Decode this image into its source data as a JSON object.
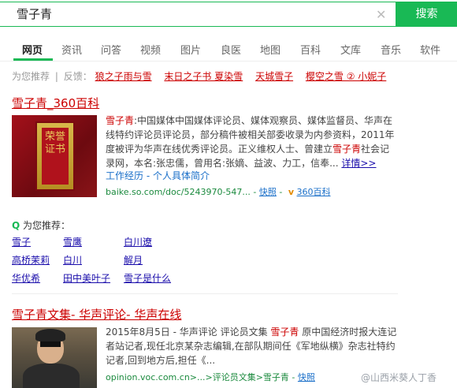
{
  "search": {
    "left_icon": "索",
    "query": "雪子青",
    "clear_icon": "clear-icon",
    "button_label": "搜索"
  },
  "tabs": [
    {
      "label": "网页",
      "active": true
    },
    {
      "label": "资讯"
    },
    {
      "label": "问答"
    },
    {
      "label": "视频"
    },
    {
      "label": "图片"
    },
    {
      "label": "良医"
    },
    {
      "label": "地图"
    },
    {
      "label": "百科"
    },
    {
      "label": "文库"
    },
    {
      "label": "音乐"
    },
    {
      "label": "软件"
    }
  ],
  "recommend_row": {
    "prefix": "为您推荐",
    "separator": "|",
    "feedback": "反馈：",
    "links": [
      "狼之子雨与雪",
      "末日之子书 夏染雪",
      "天城雪子",
      "樱空之雪 ② 小妮子"
    ]
  },
  "result1": {
    "title": "雪子青_360百科",
    "image_text": "荣誉证书",
    "desc_parts": [
      {
        "text": "雪子青",
        "hl": true
      },
      {
        "text": ":中国媒体中国媒体评论员、媒体观察员、媒体监督员、华声在线特约评论员评论员，部分稿件被相关部委收录为内参资料，2011年度被评为华声在线优秀评论员。正义维权人士、曾建立"
      },
      {
        "text": "雪子青",
        "hl": true
      },
      {
        "text": "社会记录网，本名:张忠儒，曾用名:张嫡、益波、力工，信奉..."
      }
    ],
    "more": "详情>>",
    "sub_links": "工作经历 - 个人具体简介",
    "url": "baike.so.com/doc/5243970-547...",
    "snapshot": "快照",
    "badge_icon": "v",
    "badge": "360百科"
  },
  "recommend_block": {
    "header": "为您推荐：",
    "links": [
      "雪子",
      "雪鹰",
      "白川遼",
      "高桥茉莉",
      "白川",
      "解月",
      "华优希",
      "田中美叶子",
      "雪子是什么"
    ]
  },
  "result2": {
    "title": "雪子青文集- 华声评论- 华声在线",
    "desc_parts": [
      {
        "text": "2015年8月5日 - 华声评论 评论员文集 "
      },
      {
        "text": "雪子青",
        "hl": true
      },
      {
        "text": " 原中国经济时报大连记者站记者,现任北京某杂志编辑,在部队期间任《军地纵横》杂志社特约记者,回到地方后,担任《..."
      }
    ],
    "url": "opinion.voc.com.cn>...>评论员文集>雪子青",
    "snapshot": "快照"
  },
  "watermark": "@山西米葵人丁香",
  "colors": {
    "accent": "#19b955",
    "title_red": "#cc0000",
    "link_blue": "#1a0dab",
    "url_green": "#1b8a3e"
  }
}
